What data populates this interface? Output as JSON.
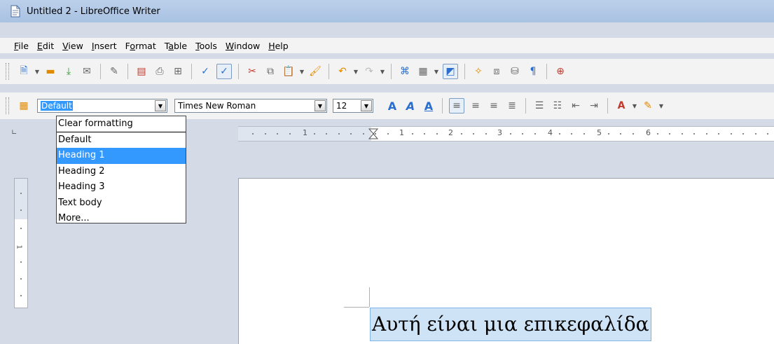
{
  "window": {
    "title": "Untitled 2 - LibreOffice Writer"
  },
  "menu": [
    {
      "pre": "",
      "ul": "F",
      "post": "ile"
    },
    {
      "pre": "",
      "ul": "E",
      "post": "dit"
    },
    {
      "pre": "",
      "ul": "V",
      "post": "iew"
    },
    {
      "pre": "",
      "ul": "I",
      "post": "nsert"
    },
    {
      "pre": "F",
      "ul": "o",
      "post": "rmat"
    },
    {
      "pre": "T",
      "ul": "a",
      "post": "ble"
    },
    {
      "pre": "",
      "ul": "T",
      "post": "ools"
    },
    {
      "pre": "",
      "ul": "W",
      "post": "indow"
    },
    {
      "pre": "",
      "ul": "H",
      "post": "elp"
    }
  ],
  "formatting": {
    "style_value": "Default",
    "font_value": "Times New Roman",
    "size_value": "12"
  },
  "style_dropdown": {
    "items": [
      "Clear formatting",
      "Default",
      "Heading 1",
      "Heading 2",
      "Heading 3",
      "Text body",
      "More..."
    ],
    "selected": "Heading 1"
  },
  "ruler": {
    "labels": [
      "1",
      "1",
      "2",
      "3",
      "4",
      "5",
      "6"
    ]
  },
  "vruler": {
    "label": "1"
  },
  "document": {
    "heading_text": "Αυτή είναι μια επικεφαλίδα"
  },
  "colors": {
    "selection": "#3399ff",
    "titlebar": "#bcd0ea",
    "workspace": "#d4dbe6"
  }
}
